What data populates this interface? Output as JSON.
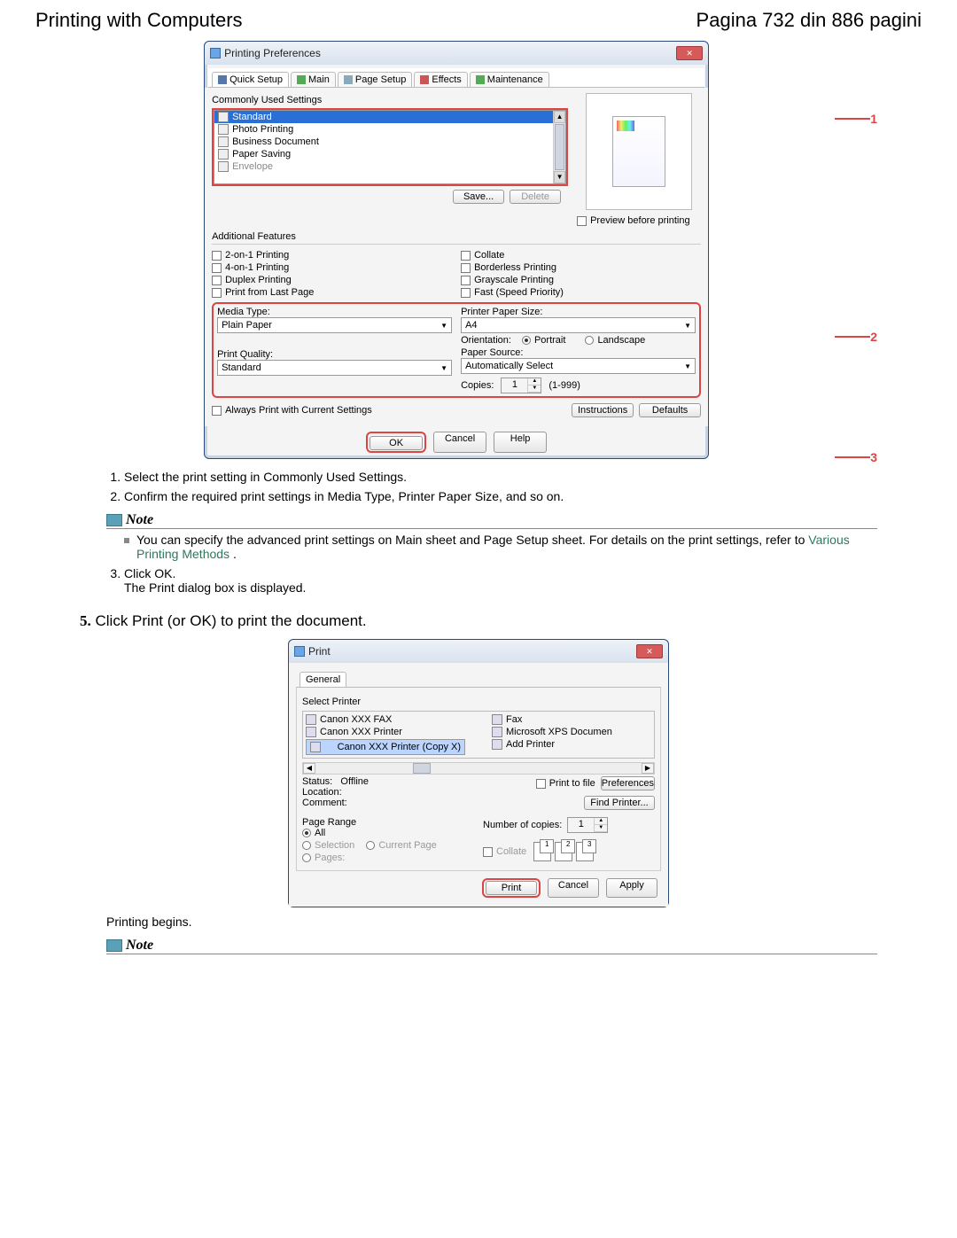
{
  "header": {
    "left": "Printing with Computers",
    "right": "Pagina 732 din 886 pagini"
  },
  "prefs": {
    "title": "Printing Preferences",
    "tabs": {
      "quick": "Quick Setup",
      "main": "Main",
      "page": "Page Setup",
      "effects": "Effects",
      "maint": "Maintenance"
    },
    "commonly_label": "Commonly Used Settings",
    "items": {
      "standard": "Standard",
      "photo": "Photo Printing",
      "business": "Business Document",
      "paper": "Paper Saving",
      "envelope": "Envelope"
    },
    "save": "Save...",
    "delete": "Delete",
    "preview": "Preview before printing",
    "addl": "Additional Features",
    "feat": {
      "twoon": "2-on-1 Printing",
      "fouron": "4-on-1 Printing",
      "duplex": "Duplex Printing",
      "last": "Print from Last Page",
      "collate": "Collate",
      "borderless": "Borderless Printing",
      "gray": "Grayscale Printing",
      "fast": "Fast (Speed Priority)"
    },
    "media_label": "Media Type:",
    "media_val": "Plain Paper",
    "quality_label": "Print Quality:",
    "quality_val": "Standard",
    "size_label": "Printer Paper Size:",
    "size_val": "A4",
    "orient_label": "Orientation:",
    "orient_portrait": "Portrait",
    "orient_land": "Landscape",
    "source_label": "Paper Source:",
    "source_val": "Automatically Select",
    "copies_label": "Copies:",
    "copies_val": "1",
    "copies_range": "(1-999)",
    "always": "Always Print with Current Settings",
    "instructions": "Instructions",
    "defaults": "Defaults",
    "ok": "OK",
    "cancel": "Cancel",
    "help": "Help"
  },
  "annot": {
    "one": "1",
    "two": "2",
    "three": "3"
  },
  "steps": {
    "s1": "Select the print setting in Commonly Used Settings.",
    "s2": "Confirm the required print settings in Media Type, Printer Paper Size, and so on.",
    "note": "Note",
    "note_body": "You can specify the advanced print settings on Main sheet and Page Setup sheet. For details on the print settings, refer to ",
    "note_link": "Various Printing Methods",
    "s3a": "Click OK.",
    "s3b": "The Print dialog box is displayed.",
    "main5_num": "5.",
    "main5": "Click Print (or OK) to print the document.",
    "begins": "Printing begins."
  },
  "print": {
    "title": "Print",
    "general": "General",
    "select_printer": "Select Printer",
    "printers": {
      "fax": "Canon XXX FAX",
      "prn": "Canon XXX Printer",
      "copy": "Canon XXX Printer (Copy X)",
      "fx": "Fax",
      "xps": "Microsoft XPS Documen",
      "add": "Add Printer"
    },
    "status_l": "Status:",
    "status_v": "Offline",
    "location_l": "Location:",
    "comment_l": "Comment:",
    "ptf": "Print to file",
    "prefs": "Preferences",
    "find": "Find Printer...",
    "range": "Page Range",
    "all": "All",
    "selection": "Selection",
    "current": "Current Page",
    "pages": "Pages:",
    "numcopies": "Number of copies:",
    "numcopies_v": "1",
    "collate": "Collate",
    "btn_print": "Print",
    "btn_cancel": "Cancel",
    "btn_apply": "Apply"
  }
}
